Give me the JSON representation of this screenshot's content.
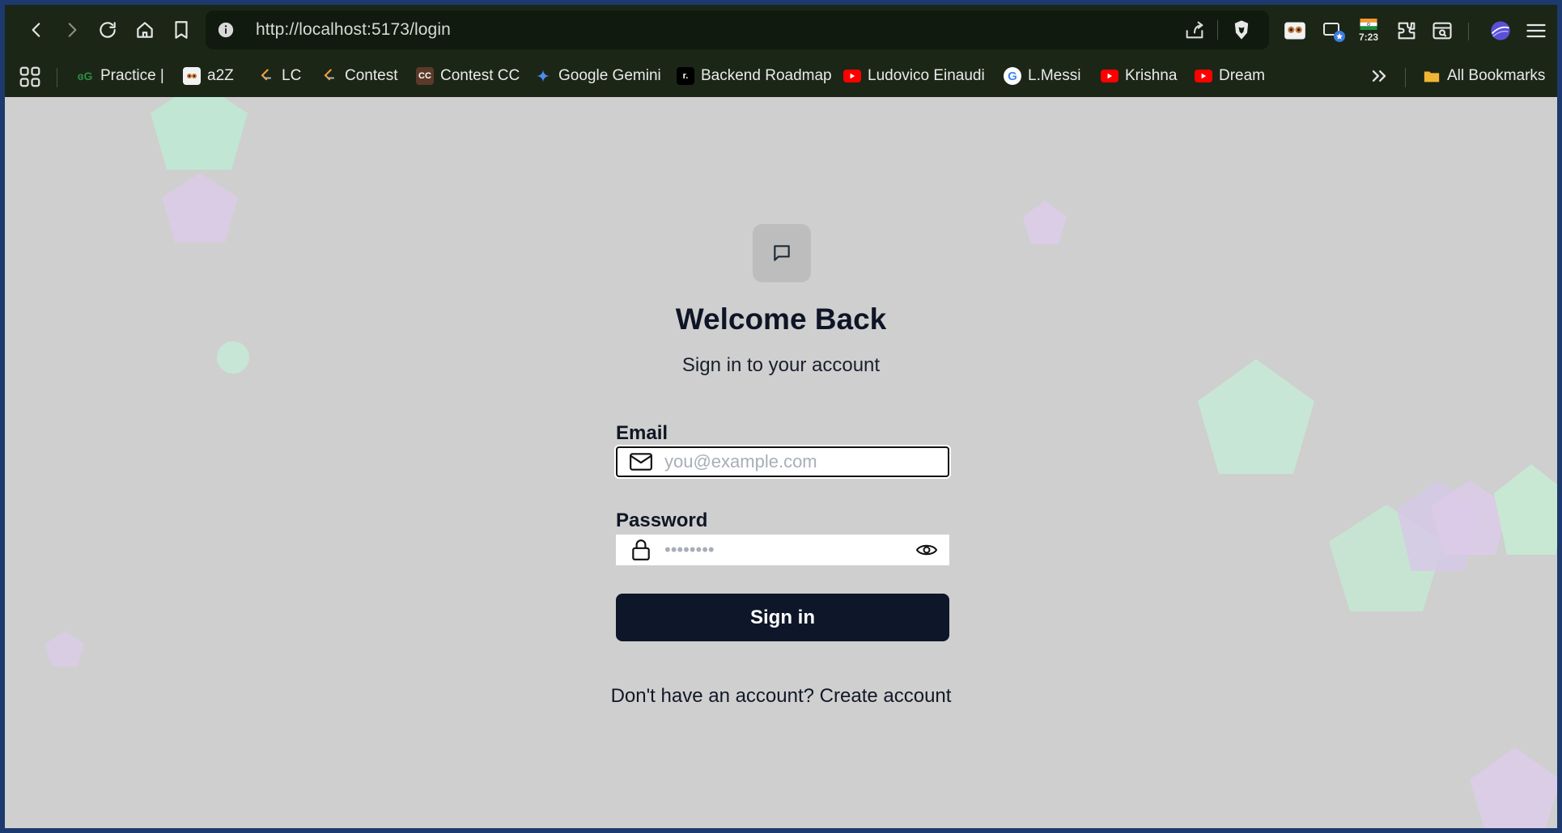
{
  "browser": {
    "url": "http://localhost:5173/login",
    "time": "7:23"
  },
  "bookmarks": [
    {
      "label": "Practice |",
      "icon": "gfg-icon"
    },
    {
      "label": "a2Z",
      "icon": "owl-icon"
    },
    {
      "label": "LC",
      "icon": "leetcode-icon"
    },
    {
      "label": "Contest",
      "icon": "leetcode-icon"
    },
    {
      "label": "Contest CC",
      "icon": "codechef-icon"
    },
    {
      "label": "Google Gemini",
      "icon": "gemini-icon"
    },
    {
      "label": "Backend Roadmap",
      "icon": "roadmap-icon"
    },
    {
      "label": "Ludovico Einaudi",
      "icon": "youtube-icon"
    },
    {
      "label": "L.Messi",
      "icon": "google-icon"
    },
    {
      "label": "Krishna",
      "icon": "youtube-icon"
    },
    {
      "label": "Dream",
      "icon": "youtube-icon"
    }
  ],
  "all_bookmarks_label": "All Bookmarks",
  "login": {
    "title": "Welcome Back",
    "subtitle": "Sign in to your account",
    "email_label": "Email",
    "email_placeholder": "you@example.com",
    "password_label": "Password",
    "password_placeholder": "••••••••",
    "submit_label": "Sign in",
    "footer_text": "Don't have an account?",
    "footer_link": "Create account"
  }
}
